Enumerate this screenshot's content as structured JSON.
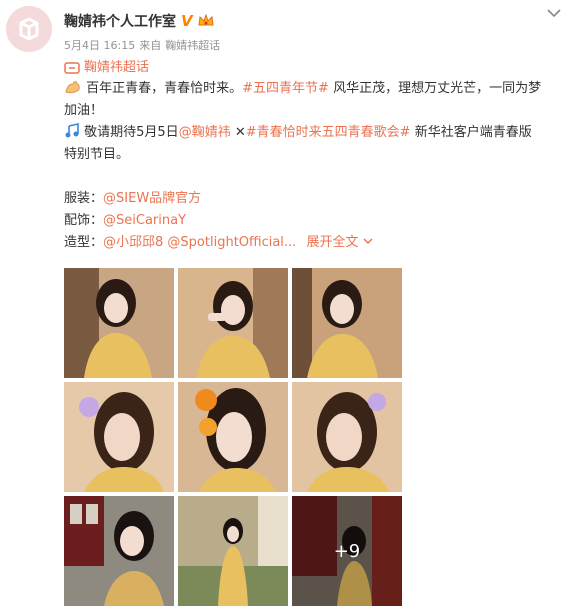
{
  "post": {
    "author": "鞠婧祎个人工作室",
    "verified_mark": "V",
    "date": "5月4日 16:15",
    "from_label": "来自",
    "source": "鞠婧祎超话",
    "topic_chip": "鞠婧祎超话",
    "line1_prefix": "百年正青春，青春恰时来。",
    "line1_tag": "#五四青年节#",
    "line1_rest": "风华正茂，理想万丈光芒，一同为梦",
    "line2": "加油！",
    "line3_prefix": "敬请期待5月5日",
    "line3_mention": "@鞠婧祎",
    "line3_cross": "✕",
    "line3_tag": "#青春恰时来五四青春歌会#",
    "line3_rest": "新华社客户端青春版",
    "line4": "特别节目。",
    "costume_label": "服装：",
    "costume_link": "@SIEW品牌官方",
    "accessory_label": "配饰：",
    "accessory_link": "@SeiCarinaY",
    "styling_label": "造型：",
    "styling_link": "@小邱邱8 @SpotlightOfficial...",
    "expand_label": "展开全文",
    "more_count": "+9"
  },
  "colors": {
    "link": "#eb7350",
    "meta": "#939393",
    "vip": "#ff8200"
  },
  "icons": [
    "sina-avatar-icon",
    "verified-v-icon",
    "vip-crown-icon",
    "chevron-down-icon",
    "muscle-emoji-icon",
    "music-note-icon"
  ],
  "images": [
    "yellow-dress-photo-1",
    "yellow-dress-photo-2",
    "yellow-dress-photo-3",
    "flower-closeup-photo-1",
    "flower-closeup-photo-2",
    "flower-closeup-photo-3",
    "garden-photo-1",
    "garden-photo-2",
    "garden-photo-3"
  ]
}
